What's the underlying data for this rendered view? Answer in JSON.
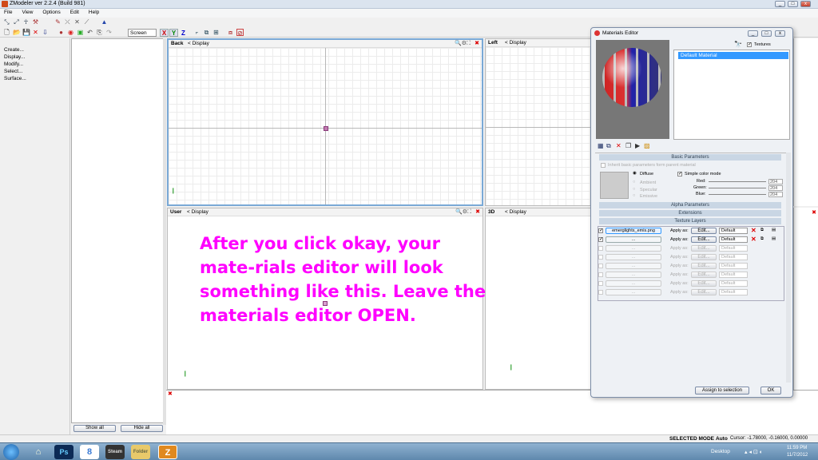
{
  "app": {
    "title": "ZModeler ver 2.2.4 (Build 981)"
  },
  "menu": [
    "File",
    "View",
    "Options",
    "Edit",
    "Help"
  ],
  "toolbar": {
    "screen_dropdown": "Screen",
    "axis_x": "X",
    "axis_y": "Y",
    "axis_z": "Z"
  },
  "left_panel": {
    "items": [
      "Create...",
      "Display...",
      "Modify...",
      "Select...",
      "Surface..."
    ]
  },
  "viewports": {
    "back": {
      "label": "Back",
      "display": "< Display"
    },
    "left": {
      "label": "Left",
      "display": "< Display"
    },
    "user": {
      "label": "User",
      "display": "< Display"
    },
    "threed": {
      "label": "3D",
      "display": "< Display"
    }
  },
  "scene": {
    "show_all": "Show all",
    "hide_all": "Hide all"
  },
  "overlay": {
    "text": "After you click okay, your mate-rials editor will look something like this. Leave the materials editor OPEN."
  },
  "materials_editor": {
    "title": "Materials Editor",
    "textures_label": "Textures",
    "material_list": [
      "Default Material"
    ],
    "basic_params": "Basic Parameters",
    "inherit_label": "Inherit basic parameters form parent material",
    "diffuse": "Diffuse",
    "ambient": "Ambient",
    "specular": "Specular",
    "emissive": "Emissive",
    "simple_color_mode": "Simple color mode",
    "red_label": "Red:",
    "green_label": "Green:",
    "blue_label": "Blue:",
    "red": "204",
    "green": "204",
    "blue": "204",
    "alpha_params": "Alpha Parameters",
    "extensions": "Extensions",
    "texture_layers": "Texture Layers",
    "layer1_texture": "emerglights_emis.png",
    "layer2_texture": "...",
    "empty_texture": "...",
    "apply_as": "Apply as:",
    "edit": "Edit...",
    "default": "Default",
    "assign": "Assign to selection",
    "ok": "OK"
  },
  "status": {
    "mode": "SELECTED MODE",
    "auto": "Auto",
    "cursor": "Cursor: -1.78000, -0.16000, 0.00000"
  },
  "taskbar": {
    "desktop": "Desktop",
    "time": "11:59 PM",
    "date": "11/7/2012",
    "apps": [
      "Ps",
      "8",
      "Steam",
      "Folder",
      "Z"
    ]
  },
  "colors": {
    "overlay": "#ff00ff",
    "accent": "#3399ff"
  }
}
